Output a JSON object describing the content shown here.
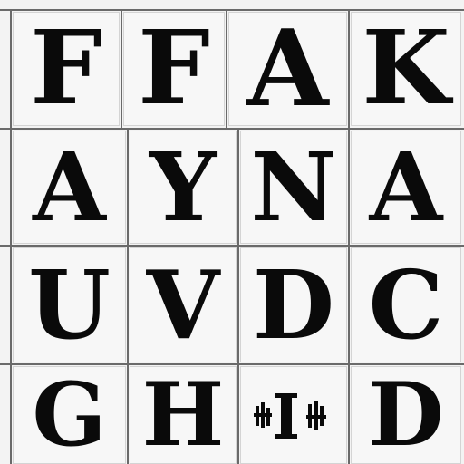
{
  "rows": [
    [
      "F",
      "F",
      "A",
      "K"
    ],
    [
      "A",
      "Y",
      "N",
      "A"
    ],
    [
      "U",
      "V",
      "D",
      "C"
    ],
    [
      "G",
      "H",
      "",
      "D"
    ]
  ]
}
